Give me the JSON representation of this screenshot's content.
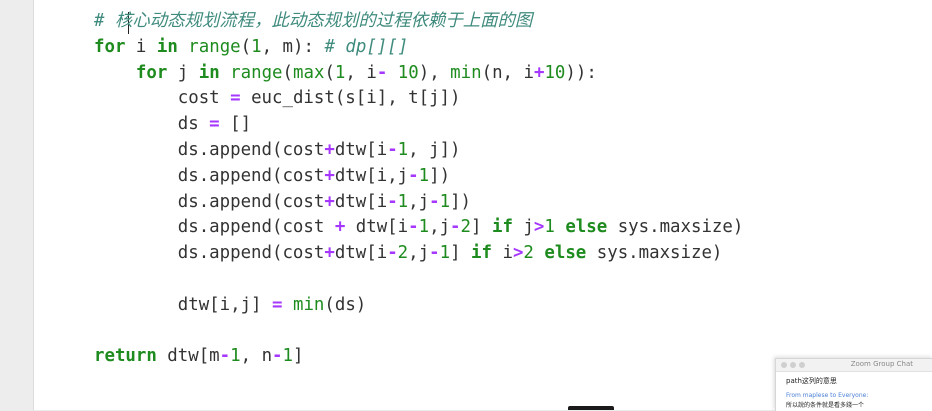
{
  "code": {
    "comment_line": "# 核心动态规划流程，此动态规划的过程依赖于上面的图",
    "lines": [
      "for i in range(1, m): # dp[][]",
      "    for j in range(max(1, i- 10), min(n, i+10)):",
      "        cost = euc_dist(s[i], t[j])",
      "        ds = []",
      "        ds.append(cost+dtw[i-1, j])",
      "        ds.append(cost+dtw[i,j-1])",
      "        ds.append(cost+dtw[i-1,j-1])",
      "        ds.append(cost + dtw[i-1,j-2] if j>1 else sys.maxsize)",
      "        ds.append(cost+dtw[i-2,j-1] if i>2 else sys.maxsize)",
      "",
      "        dtw[i,j] = min(ds)",
      "",
      "return dtw[m-1, n-1]"
    ]
  },
  "chat": {
    "title": "Zoom Group Chat",
    "message1": "path这列的意思",
    "from_label": "From maplese to Everyone:",
    "message2": "所以說的条件就是看多錢一个"
  },
  "colors": {
    "keyword": "#1e8b1e",
    "operator": "#a637ff",
    "comment": "#3f8b7e",
    "text": "#333333",
    "background": "#ffffff"
  }
}
